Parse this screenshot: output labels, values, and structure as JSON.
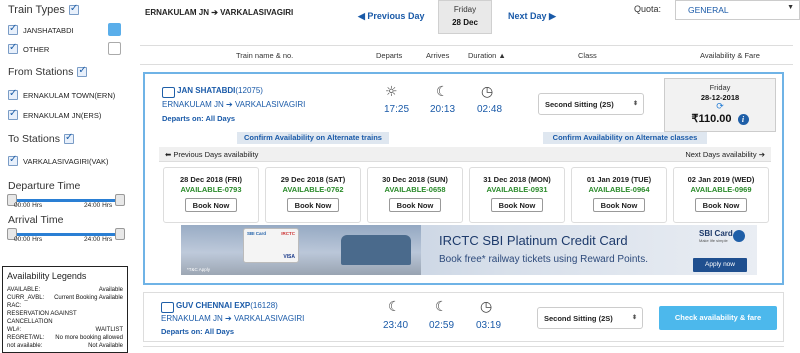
{
  "sidebar": {
    "train_types_title": "Train Types",
    "train_types": [
      {
        "label": "JANSHATABDI",
        "color": "#5aaeea"
      },
      {
        "label": "OTHER",
        "color": "#ffffff"
      }
    ],
    "from_stations_title": "From Stations",
    "from_stations": [
      "ERNAKULAM TOWN(ERN)",
      "ERNAKULAM JN(ERS)"
    ],
    "to_stations_title": "To Stations",
    "to_stations": [
      "VARKALASIVAGIRI(VAK)"
    ],
    "departure_title": "Departure Time",
    "departure_range": {
      "from": "00:00 Hrs",
      "to": "24:00 Hrs"
    },
    "arrival_title": "Arrival Time",
    "arrival_range": {
      "from": "00:00 Hrs",
      "to": "24:00 Hrs"
    },
    "legend": {
      "title": "Availability Legends",
      "rows": [
        {
          "key": "AVAILABLE:",
          "value": "Available"
        },
        {
          "key": "CURR_AVBL:",
          "value": "Current Booking Available"
        },
        {
          "key": "RAC:",
          "value": ""
        },
        {
          "key": "RESERVATION AGAINST CANCELLATION",
          "value": ""
        },
        {
          "key": "WL#:",
          "value": "WAITLIST"
        },
        {
          "key": "REGRET/WL:",
          "value": "No more booking allowed"
        },
        {
          "key": "not available:",
          "value": "Not Available"
        }
      ]
    }
  },
  "topbar": {
    "route": "ERNAKULAM JN ➔ VARKALASIVAGIRI",
    "prev_day": "◀ Previous Day",
    "day_name": "Friday",
    "day_date": "28 Dec",
    "next_day": "Next Day ▶",
    "quota_label": "Quota:",
    "quota_value": "GENERAL",
    "quota_caret": "▼"
  },
  "columns": {
    "train": "Train name & no.",
    "departs": "Departs",
    "arrives": "Arrives",
    "duration": "Duration ▲",
    "class": "Class",
    "fare": "Availability & Fare"
  },
  "train1": {
    "name": "JAN SHATABDI",
    "number": "(12075)",
    "route": "ERNAKULAM JN ➔ VARKALASIVAGIRI",
    "departs_on": "Departs on: All Days",
    "depart_time": "17:25",
    "arrive_time": "20:13",
    "duration": "02:48",
    "class": "Second Sitting (2S)",
    "fare_day": "Friday",
    "fare_date": "28-12-2018",
    "fare": "₹110.00",
    "alt_trains": "Confirm Availability on Alternate trains",
    "alt_classes": "Confirm Availability on Alternate classes",
    "prev_days": "⬅ Previous Days availability",
    "next_days": "Next Days availability ➔",
    "days": [
      {
        "date": "28 Dec 2018 (FRI)",
        "avail": "AVAILABLE-0793",
        "btn": "Book Now"
      },
      {
        "date": "29 Dec 2018 (SAT)",
        "avail": "AVAILABLE-0762",
        "btn": "Book Now"
      },
      {
        "date": "30 Dec 2018 (SUN)",
        "avail": "AVAILABLE-0658",
        "btn": "Book Now"
      },
      {
        "date": "31 Dec 2018 (MON)",
        "avail": "AVAILABLE-0931",
        "btn": "Book Now"
      },
      {
        "date": "01 Jan 2019 (TUE)",
        "avail": "AVAILABLE-0964",
        "btn": "Book Now"
      },
      {
        "date": "02 Jan 2019 (WED)",
        "avail": "AVAILABLE-0969",
        "btn": "Book Now"
      }
    ]
  },
  "ad": {
    "title": "IRCTC SBI Platinum Credit Card",
    "subtitle": "Book free* railway tickets using Reward Points.",
    "brand": "SBI Card",
    "brand_tag": "Make life simple",
    "apply": "Apply now",
    "tbc": "*T&C Apply",
    "card_sbi": "SBI Card",
    "card_irctc": "IRCTC",
    "card_visa": "VISA"
  },
  "train2": {
    "name": "GUV CHENNAI EXP",
    "number": "(16128)",
    "route": "ERNAKULAM JN ➔ VARKALASIVAGIRI",
    "departs_on": "Departs on: All Days",
    "depart_time": "23:40",
    "arrive_time": "02:59",
    "duration": "03:19",
    "class": "Second Sitting (2S)",
    "check_btn": "Check availability & fare"
  }
}
